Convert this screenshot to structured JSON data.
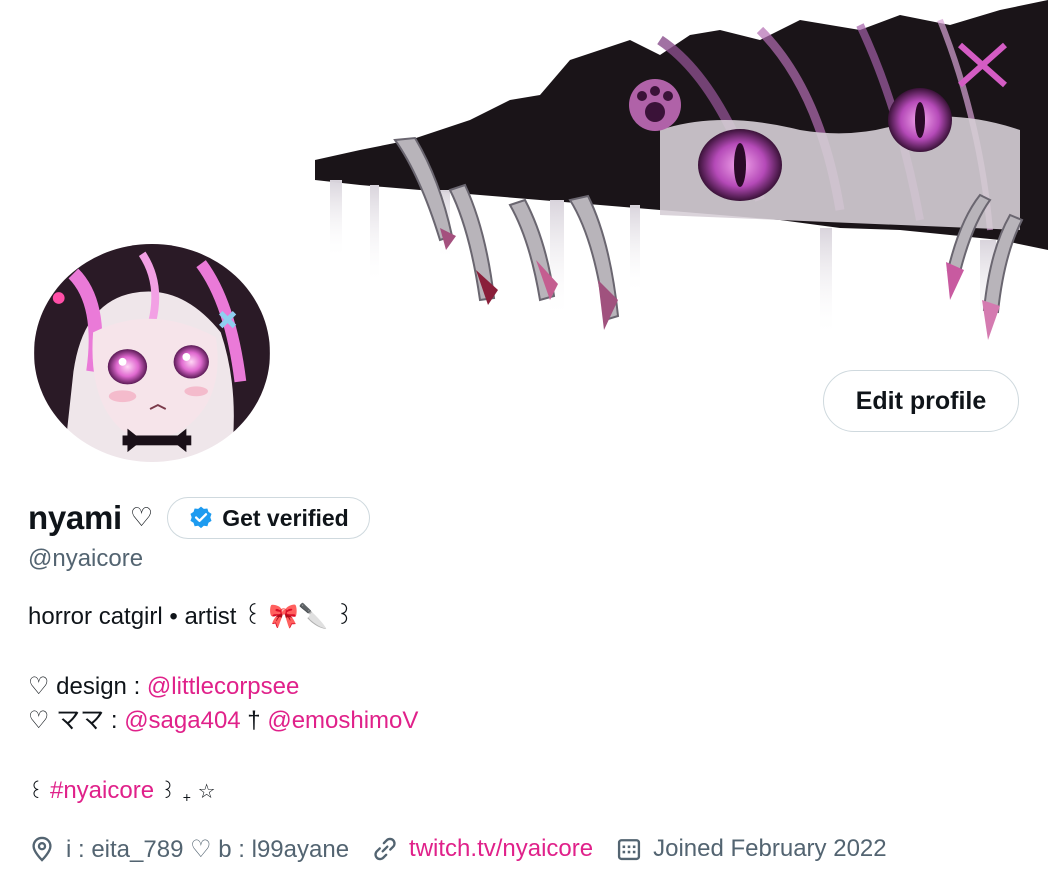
{
  "profile": {
    "display_name": "nyami",
    "name_suffix": "♡",
    "get_verified_label": "Get verified",
    "handle": "@nyaicore",
    "edit_profile_label": "Edit profile"
  },
  "bio": {
    "line1": "horror catgirl • artist ꒰ 🎀🔪 ꒱",
    "line2_prefix": "♡ design : ",
    "line2_link": "@littlecorpsee",
    "line3_prefix": "♡ ママ : ",
    "line3_link1": "@saga404",
    "line3_sep": " † ",
    "line3_link2": "@emoshimoV",
    "line4_open": "꒰ ",
    "line4_tag": "#nyaicore",
    "line4_close": " ꒱",
    "line4_plus": "+",
    "line4_star": "☆"
  },
  "meta": {
    "location": "i : eita_789 ♡ b : l99ayane",
    "website": "twitch.tv/nyaicore",
    "joined": "Joined February 2022"
  },
  "icons": {
    "location": "location-pin-icon",
    "link": "link-icon",
    "calendar": "calendar-icon",
    "verified": "verified-badge-icon"
  },
  "colors": {
    "accent_link": "#e0218a",
    "secondary_text": "#536471",
    "verified_blue": "#1d9bf0",
    "border": "#cfd9de"
  }
}
